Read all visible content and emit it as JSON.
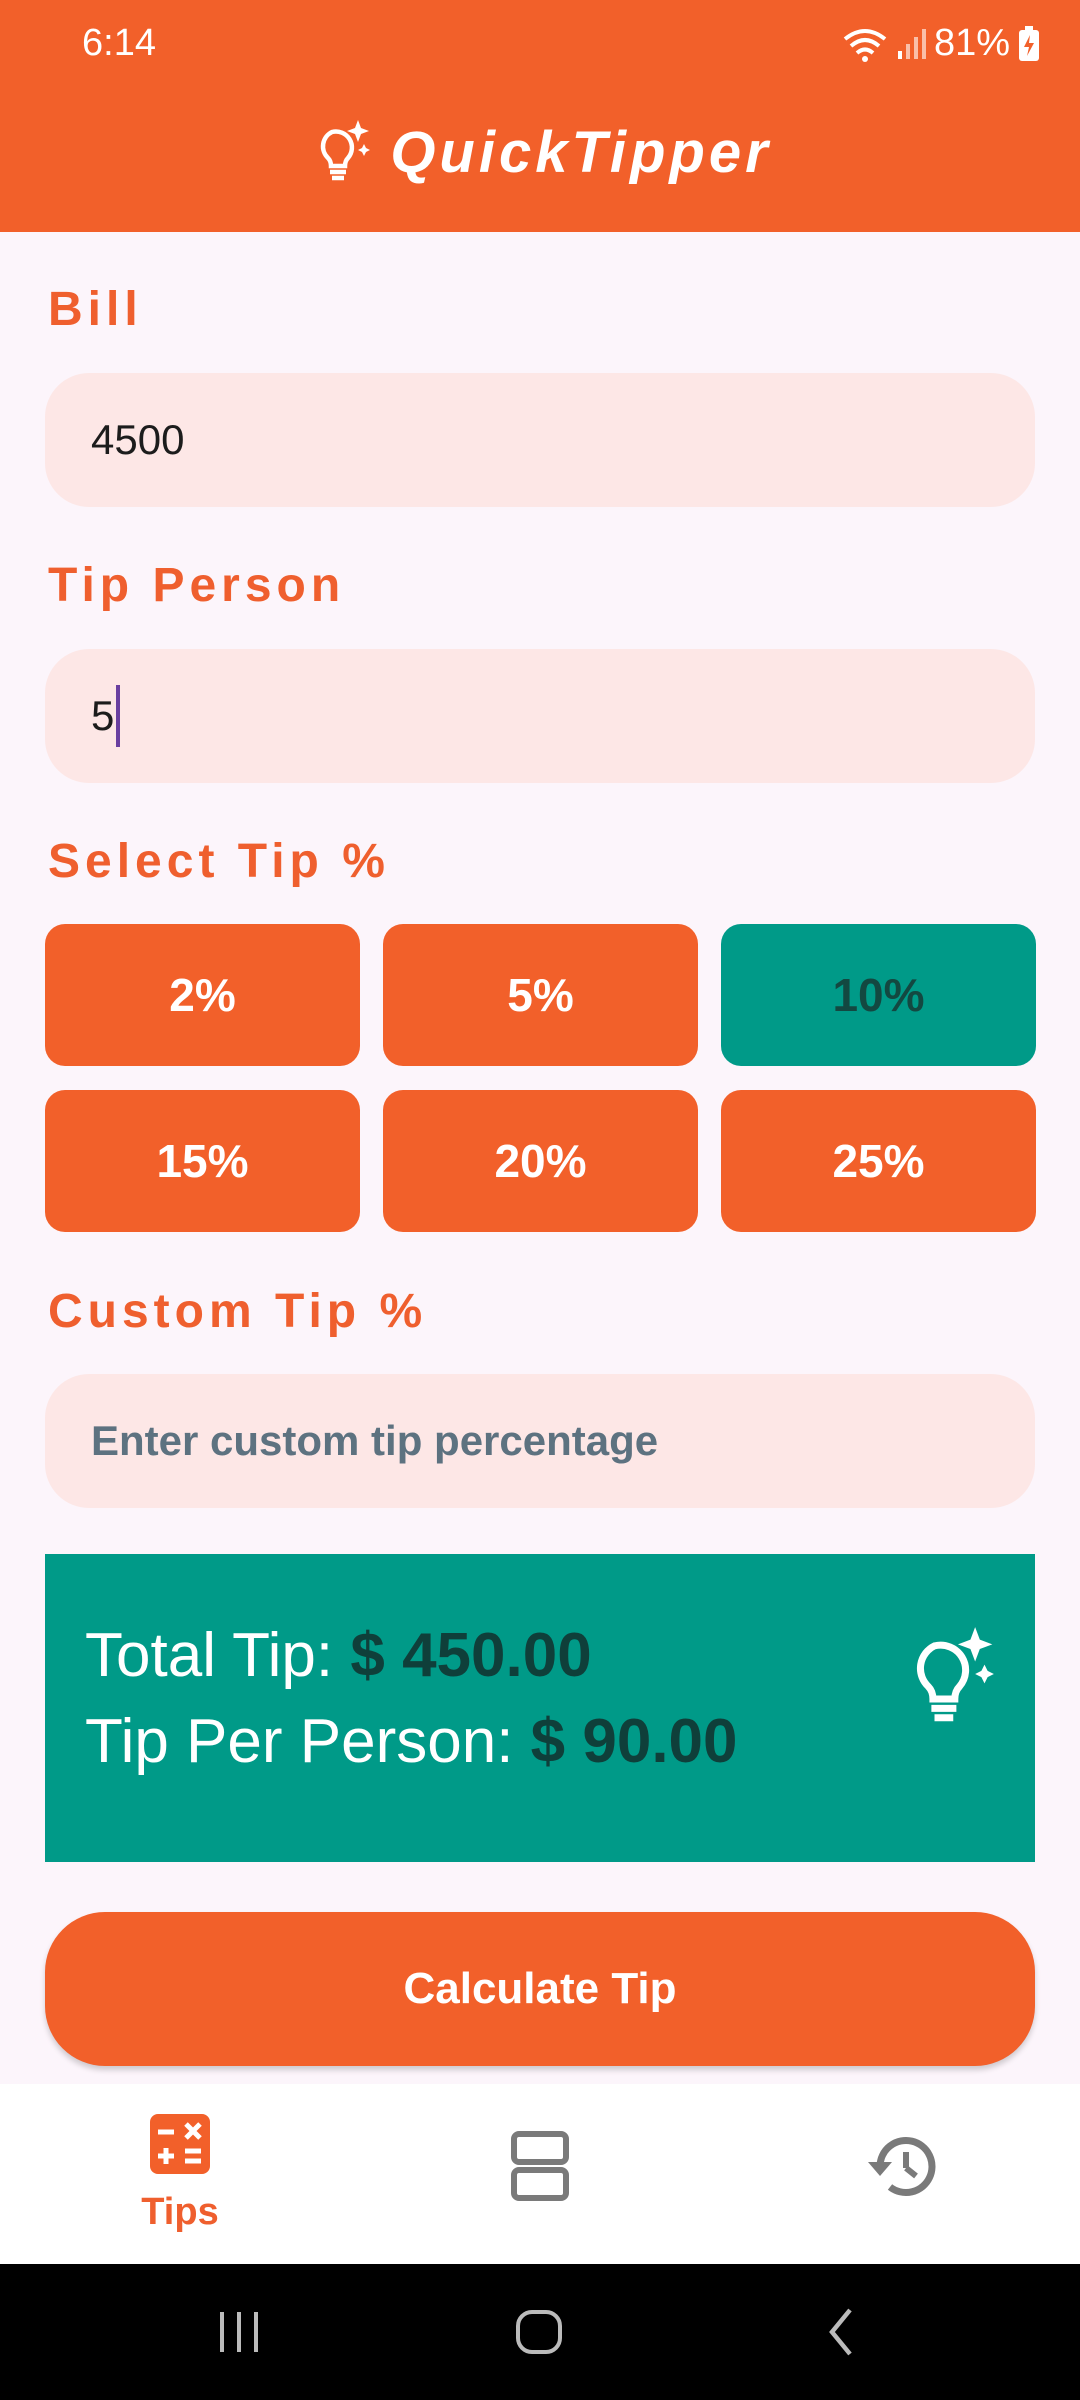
{
  "status_bar": {
    "time": "6:14",
    "battery": "81%"
  },
  "app": {
    "title": "QuickTipper",
    "icon": "lightbulb-sparkle-icon"
  },
  "bill": {
    "label": "Bill",
    "value": "4500"
  },
  "tip_person": {
    "label": "Tip Person",
    "value": "5"
  },
  "select_tip": {
    "label": "Select Tip %",
    "options": [
      {
        "label": "2%",
        "selected": false
      },
      {
        "label": "5%",
        "selected": false
      },
      {
        "label": "10%",
        "selected": true
      },
      {
        "label": "15%",
        "selected": false
      },
      {
        "label": "20%",
        "selected": false
      },
      {
        "label": "25%",
        "selected": false
      }
    ]
  },
  "custom_tip": {
    "label": "Custom Tip %",
    "placeholder": "Enter custom tip percentage",
    "value": ""
  },
  "result": {
    "total_tip_label": "Total Tip: ",
    "total_tip_value": "$ 450.00",
    "per_person_label": "Tip Per Person: ",
    "per_person_value": "$ 90.00",
    "icon": "lightbulb-sparkle-icon"
  },
  "calculate_button": "Calculate Tip",
  "bottom_nav": {
    "items": [
      {
        "label": "Tips",
        "icon": "calculator-icon",
        "active": true
      },
      {
        "label": "",
        "icon": "split-layout-icon",
        "active": false
      },
      {
        "label": "",
        "icon": "history-icon",
        "active": false
      }
    ]
  },
  "colors": {
    "primary": "#f2602a",
    "accent": "#009a88",
    "field_bg": "#fde7e6",
    "page_bg": "#fcf5fb"
  }
}
